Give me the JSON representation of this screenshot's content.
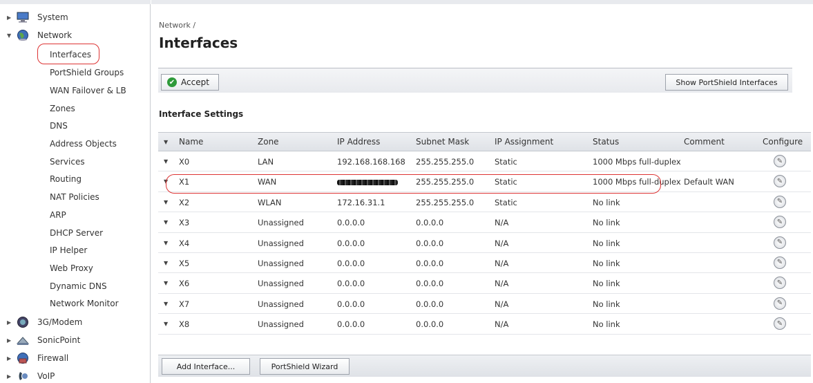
{
  "sidebar": {
    "categories_top": [
      {
        "label": "System",
        "icon": "monitor-icon",
        "expanded": false
      },
      {
        "label": "Network",
        "icon": "globe-icon",
        "expanded": true
      }
    ],
    "network_items": [
      "Interfaces",
      "PortShield Groups",
      "WAN Failover & LB",
      "Zones",
      "DNS",
      "Address Objects",
      "Services",
      "Routing",
      "NAT Policies",
      "ARP",
      "DHCP Server",
      "IP Helper",
      "Web Proxy",
      "Dynamic DNS",
      "Network Monitor"
    ],
    "selected_item": "Interfaces",
    "categories_bottom": [
      {
        "label": "3G/Modem",
        "icon": "modem-icon",
        "expanded": false
      },
      {
        "label": "SonicPoint",
        "icon": "access-point-icon",
        "expanded": false
      },
      {
        "label": "Firewall",
        "icon": "firewall-icon",
        "expanded": false
      },
      {
        "label": "VoIP",
        "icon": "voip-icon",
        "expanded": false
      }
    ]
  },
  "main": {
    "breadcrumb": "Network /",
    "title": "Interfaces",
    "accept_label": "Accept",
    "show_portshield_label": "Show PortShield Interfaces",
    "section_title": "Interface Settings",
    "columns": [
      "Name",
      "Zone",
      "IP Address",
      "Subnet Mask",
      "IP Assignment",
      "Status",
      "Comment",
      "Configure"
    ],
    "rows": [
      {
        "name": "X0",
        "zone": "LAN",
        "ip": "192.168.168.168",
        "mask": "255.255.255.0",
        "assign": "Static",
        "status": "1000 Mbps full-duplex",
        "comment": ""
      },
      {
        "name": "X1",
        "zone": "WAN",
        "ip": "",
        "mask": "255.255.255.0",
        "assign": "Static",
        "status": "1000 Mbps full-duplex",
        "comment": "Default WAN"
      },
      {
        "name": "X2",
        "zone": "WLAN",
        "ip": "172.16.31.1",
        "mask": "255.255.255.0",
        "assign": "Static",
        "status": "No link",
        "comment": ""
      },
      {
        "name": "X3",
        "zone": "Unassigned",
        "ip": "0.0.0.0",
        "mask": "0.0.0.0",
        "assign": "N/A",
        "status": "No link",
        "comment": ""
      },
      {
        "name": "X4",
        "zone": "Unassigned",
        "ip": "0.0.0.0",
        "mask": "0.0.0.0",
        "assign": "N/A",
        "status": "No link",
        "comment": ""
      },
      {
        "name": "X5",
        "zone": "Unassigned",
        "ip": "0.0.0.0",
        "mask": "0.0.0.0",
        "assign": "N/A",
        "status": "No link",
        "comment": ""
      },
      {
        "name": "X6",
        "zone": "Unassigned",
        "ip": "0.0.0.0",
        "mask": "0.0.0.0",
        "assign": "N/A",
        "status": "No link",
        "comment": ""
      },
      {
        "name": "X7",
        "zone": "Unassigned",
        "ip": "0.0.0.0",
        "mask": "0.0.0.0",
        "assign": "N/A",
        "status": "No link",
        "comment": ""
      },
      {
        "name": "X8",
        "zone": "Unassigned",
        "ip": "0.0.0.0",
        "mask": "0.0.0.0",
        "assign": "N/A",
        "status": "No link",
        "comment": ""
      }
    ],
    "add_interface_label": "Add Interface...",
    "portshield_wizard_label": "PortShield Wizard",
    "highlight_color": "#dd3333"
  }
}
